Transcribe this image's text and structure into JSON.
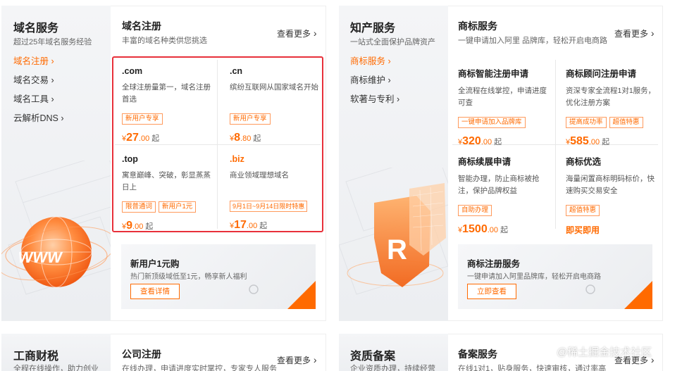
{
  "domain_section": {
    "side": {
      "title": "域名服务",
      "subtitle": "超过25年域名服务经验",
      "links": [
        "域名注册",
        "域名交易",
        "域名工具",
        "云解析DNS"
      ]
    },
    "panel": {
      "title": "域名注册",
      "subtitle": "丰富的域名种类供您挑选",
      "more": "查看更多",
      "cards": [
        {
          "name": ".com",
          "desc": "全球注册量第一，域名注册首选",
          "tags": [
            "新用户专享"
          ],
          "price_symbol": "¥",
          "price_int": "27",
          "price_dec": ".00",
          "unit": "起"
        },
        {
          "name": ".cn",
          "desc": "缤纷互联网从国家域名开始",
          "tags": [
            "新用户专享"
          ],
          "price_symbol": "¥",
          "price_int": "8",
          "price_dec": ".80",
          "unit": "起"
        },
        {
          "name": ".top",
          "desc": "寓意巅峰、突破，彰显蒸蒸日上",
          "tags": [
            "限普通词",
            "新用户1元"
          ],
          "price_symbol": "¥",
          "price_int": "9",
          "price_dec": ".00",
          "unit": "起"
        },
        {
          "name": ".biz",
          "desc": "商业领域理想域名",
          "tags": [
            "9月1日~9月14日限时特惠"
          ],
          "price_symbol": "¥",
          "price_int": "17",
          "price_dec": ".00",
          "unit": "起"
        }
      ],
      "promo": {
        "title": "新用户1元购",
        "desc": "热门新顶级域低至1元，畅享新人福利",
        "button": "查看详情"
      }
    }
  },
  "ip_section": {
    "side": {
      "title": "知产服务",
      "subtitle": "一站式全面保护品牌资产",
      "links": [
        "商标服务",
        "商标维护",
        "软著与专利"
      ]
    },
    "panel": {
      "title": "商标服务",
      "subtitle": "一键申请加入阿里 品牌库，轻松开启电商路",
      "more": "查看更多",
      "cards": [
        {
          "name": "商标智能注册申请",
          "desc": "全流程在线掌控，申请进度可查",
          "tags": [
            "一键申请加入品牌库"
          ],
          "price_symbol": "¥",
          "price_int": "320",
          "price_dec": ".00",
          "unit": "起"
        },
        {
          "name": "商标顾问注册申请",
          "desc": "资深专家全流程1对1服务，优化注册方案",
          "tags": [
            "提高成功率",
            "超值特惠"
          ],
          "price_symbol": "¥",
          "price_int": "585",
          "price_dec": ".00",
          "unit": "起"
        },
        {
          "name": "商标续展申请",
          "desc": "智能办理，防止商标被抢注，保护品牌权益",
          "tags": [
            "自助办理"
          ],
          "price_symbol": "¥",
          "price_int": "1500",
          "price_dec": ".00",
          "unit": "起"
        },
        {
          "name": "商标优选",
          "desc": "海量闲置商标明码标价，快速购买交易安全",
          "tags": [
            "超值特惠"
          ],
          "buy_now": "即买即用"
        }
      ],
      "promo": {
        "title": "商标注册服务",
        "desc": "一键申请加入阿里品牌库，轻松开启电商路",
        "button": "立即查看"
      }
    }
  },
  "bottom_left": {
    "side": {
      "title": "工商财税",
      "subtitle": "全程在线操作，助力创业"
    },
    "panel": {
      "title": "公司注册",
      "subtitle": "在线办理，申请进度实时掌控，专家专人服务",
      "more": "查看更多"
    }
  },
  "bottom_right": {
    "side": {
      "title": "资质备案",
      "subtitle": "企业资质办理，持续经营"
    },
    "panel": {
      "title": "备案服务",
      "subtitle": "在线1对1，贴身服务，快速审核，通过率高",
      "more": "查看更多"
    }
  },
  "illustration": {
    "www_text": "WWW",
    "r_text": "R"
  },
  "watermark": "@稀土掘金技术社区",
  "colors": {
    "accent": "#ff6a00",
    "highlight_border": "#e8303a",
    "side_bg": "#f1f2f4"
  }
}
